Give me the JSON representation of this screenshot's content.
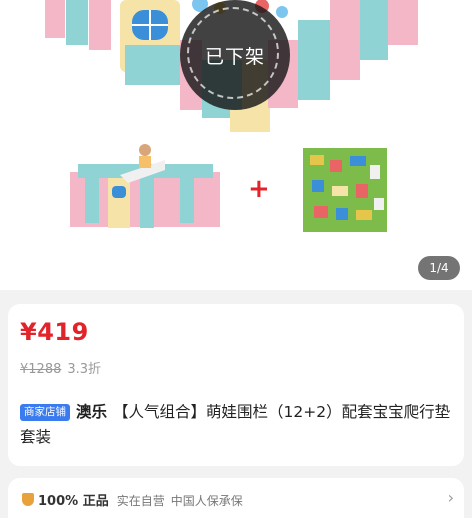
{
  "gallery": {
    "delisted_label": "已下架",
    "plus_label": "+",
    "page_indicator": "1/4"
  },
  "product": {
    "price": "¥419",
    "original_price": "¥1288",
    "discount": "3.3折",
    "shop_tag": "商家店铺",
    "brand": "澳乐",
    "title": "【人气组合】萌娃围栏（12+2）配套宝宝爬行垫套装"
  },
  "services": {
    "headline": "100% 正品",
    "items": [
      "实在自营",
      "中国人保承保"
    ]
  },
  "colors": {
    "price_red": "#e2232a",
    "shop_tag_blue": "#3a7cf0"
  }
}
